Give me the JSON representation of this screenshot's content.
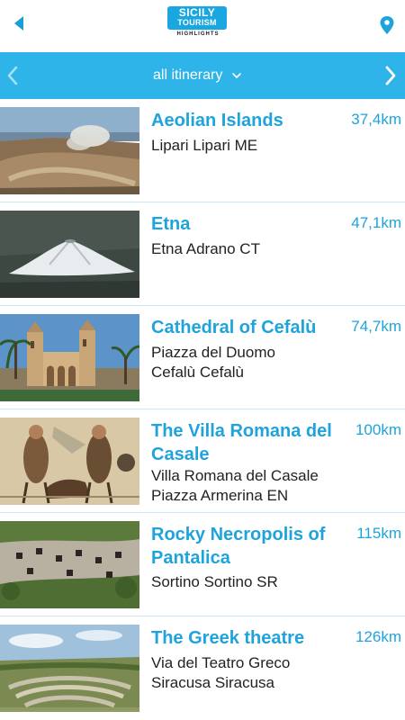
{
  "header": {
    "logo_line1": "SICILY",
    "logo_line2": "TOURISM",
    "logo_sub": "HIGHLIGHTS",
    "accent": "#1ea3dd"
  },
  "filter": {
    "selected": "all itinerary",
    "bar_color": "#2fb4ea"
  },
  "items": [
    {
      "title": "Aeolian Islands",
      "distance": "37,4km",
      "address_line1": "Lipari Lipari ME",
      "address_line2": ""
    },
    {
      "title": "Etna",
      "distance": "47,1km",
      "address_line1": "Etna Adrano CT",
      "address_line2": ""
    },
    {
      "title": "Cathedral of Cefalù",
      "distance": "74,7km",
      "address_line1": "Piazza del Duomo",
      "address_line2": "Cefalù Cefalù"
    },
    {
      "title": "The Villa Romana del Casale",
      "distance": "100km",
      "address_line1": "Villa Romana del Casale",
      "address_line2": "Piazza Armerina EN"
    },
    {
      "title": "Rocky Necropolis of Pantalica",
      "distance": "115km",
      "address_line1": "Sortino Sortino SR",
      "address_line2": ""
    },
    {
      "title": "The Greek theatre",
      "distance": "126km",
      "address_line1": "Via del Teatro Greco",
      "address_line2": "Siracusa Siracusa"
    }
  ]
}
